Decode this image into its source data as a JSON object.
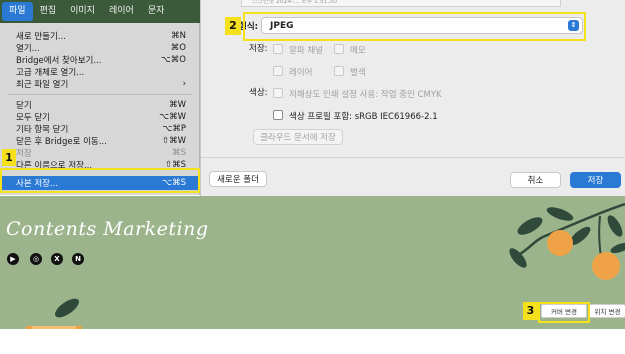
{
  "menubar": {
    "items": [
      "파일",
      "편집",
      "이미지",
      "레이어",
      "문자"
    ]
  },
  "file_menu": {
    "items": [
      {
        "label": "새로 만들기...",
        "shortcut": "⌘N"
      },
      {
        "label": "열기...",
        "shortcut": "⌘O"
      },
      {
        "label": "Bridge에서 찾아보기...",
        "shortcut": "⌥⌘O"
      },
      {
        "label": "고급 개체로 열기...",
        "shortcut": ""
      },
      {
        "label": "최근 파일 열기",
        "shortcut": "›"
      },
      {
        "label": "닫기",
        "shortcut": "⌘W"
      },
      {
        "label": "모두 닫기",
        "shortcut": "⌥⌘W"
      },
      {
        "label": "기타 항목 닫기",
        "shortcut": "⌥⌘P"
      },
      {
        "label": "닫은 후 Bridge로 이동...",
        "shortcut": "⇧⌘W"
      },
      {
        "label": "저장",
        "shortcut": "⌘S"
      },
      {
        "label": "다른 이름으로 저장...",
        "shortcut": "⇧⌘S"
      },
      {
        "label": "사본 저장...",
        "shortcut": "⌥⌘S"
      }
    ]
  },
  "dialog": {
    "top_strip": "스크린샷 2024-... 오후 1.51.30",
    "format_label": "형식:",
    "format_value": "JPEG",
    "save_label": "저장:",
    "opt_alpha": "알파 채널",
    "opt_memo": "메모",
    "opt_layers": "레이어",
    "opt_spot": "별색",
    "color_label": "색상:",
    "opt_lowres": "저해상도 인쇄 설정 사용: 작업 중인 CMYK",
    "opt_profile": "색상 프로필 포함: sRGB IEC61966-2.1",
    "cloud_button": "클라우드 문서에 저장",
    "new_folder_button": "새로운 폴더",
    "cancel_button": "취소",
    "save_button": "저장"
  },
  "annotations": {
    "one": "1",
    "two": "2",
    "three": "3"
  },
  "banner": {
    "title": "Contents Marketing",
    "cover_change_button": "커버 변경",
    "position_change_button": "위치 변경",
    "bg_color": "#9bb48c"
  },
  "icons": [
    "youtube-icon",
    "instagram-icon",
    "x-icon",
    "naver-icon"
  ]
}
